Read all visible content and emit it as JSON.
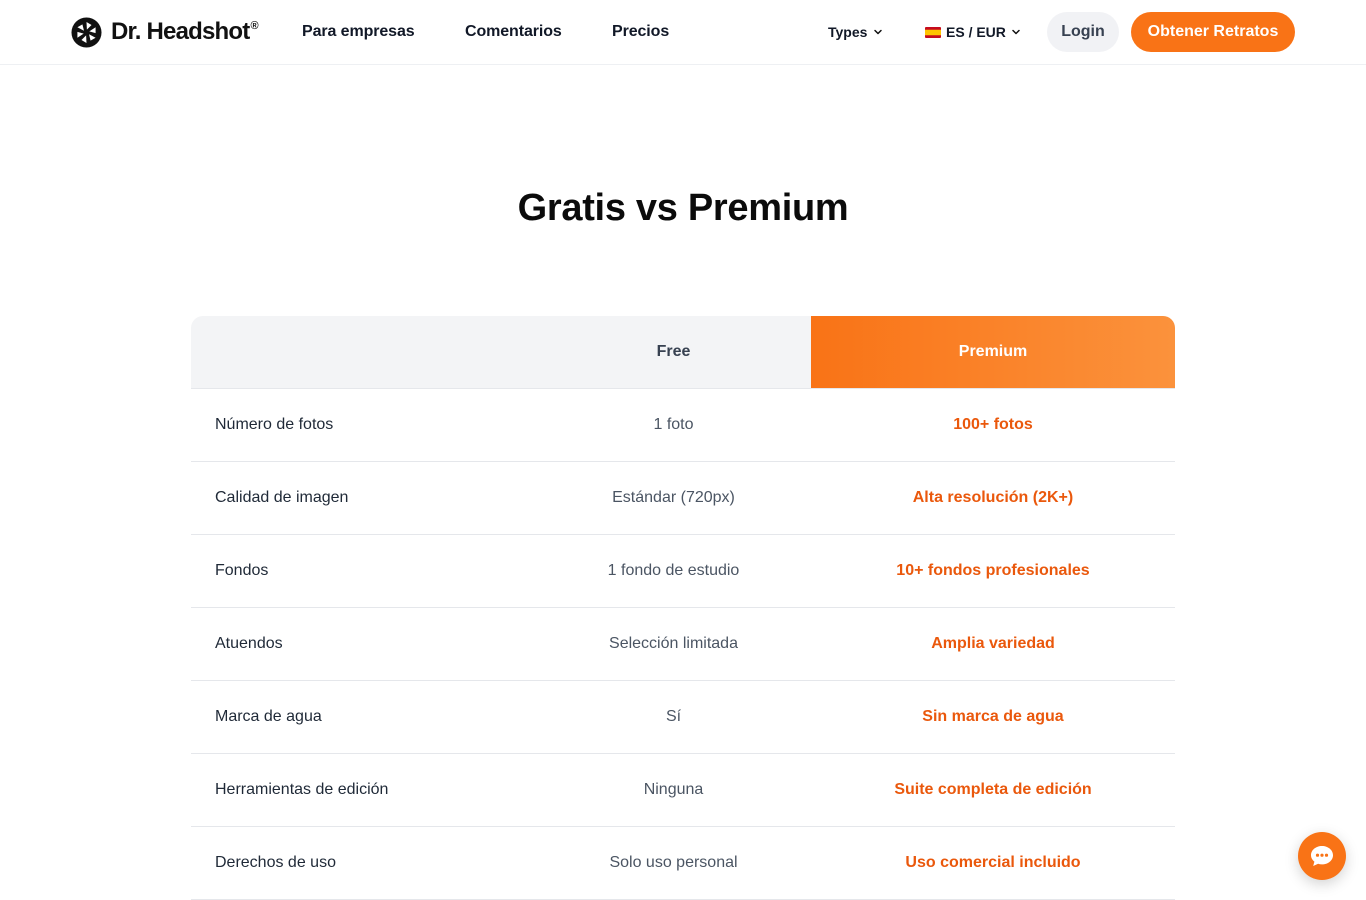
{
  "brand": {
    "name": "Dr. Headshot",
    "reg_mark": "®"
  },
  "nav": {
    "items": [
      {
        "label": "Para empresas"
      },
      {
        "label": "Comentarios"
      },
      {
        "label": "Precios"
      }
    ],
    "types_label": "Types",
    "lang_label": "ES / EUR",
    "login_label": "Login",
    "cta_label": "Obtener Retratos"
  },
  "main": {
    "title": "Gratis vs Premium"
  },
  "comparison": {
    "columns": {
      "free": "Free",
      "premium": "Premium"
    },
    "rows": [
      {
        "feature": "Número de fotos",
        "free": "1 foto",
        "premium": "100+ fotos"
      },
      {
        "feature": "Calidad de imagen",
        "free": "Estándar (720px)",
        "premium": "Alta resolución (2K+)"
      },
      {
        "feature": "Fondos",
        "free": "1 fondo de estudio",
        "premium": "10+ fondos profesionales"
      },
      {
        "feature": "Atuendos",
        "free": "Selección limitada",
        "premium": "Amplia variedad"
      },
      {
        "feature": "Marca de agua",
        "free": "Sí",
        "premium": "Sin marca de agua"
      },
      {
        "feature": "Herramientas de edición",
        "free": "Ninguna",
        "premium": "Suite completa de edición"
      },
      {
        "feature": "Derechos de uso",
        "free": "Solo uso personal",
        "premium": "Uso comercial incluido"
      }
    ]
  },
  "icons": {
    "logo": "aperture-icon",
    "types_chevron": "chevron-down-icon",
    "lang_flag": "spain-flag-icon",
    "lang_chevron": "chevron-down-icon",
    "chat": "chat-bubble-icon"
  },
  "colors": {
    "accent": "#f97316",
    "accent_text": "#ea580c",
    "header_bg": "#f3f4f6",
    "login_bg": "#f1f2f5"
  }
}
